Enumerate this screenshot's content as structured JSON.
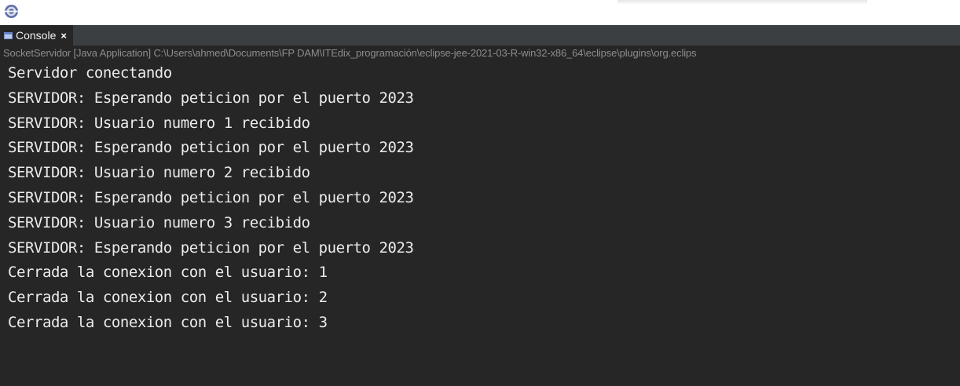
{
  "app": {
    "icon": "eclipse-icon"
  },
  "console": {
    "tab_label": "Console",
    "tab_icon": "console-icon",
    "close_glyph": "×",
    "launch_info": "SocketServidor [Java Application] C:\\Users\\ahmed\\Documents\\FP DAM\\ITEdix_programación\\eclipse-jee-2021-03-R-win32-x86_64\\eclipse\\plugins\\org.eclips",
    "lines": [
      "Servidor conectando",
      "SERVIDOR: Esperando peticion por el puerto 2023",
      "SERVIDOR: Usuario numero 1 recibido",
      "SERVIDOR: Esperando peticion por el puerto 2023",
      "SERVIDOR: Usuario numero 2 recibido",
      "SERVIDOR: Esperando peticion por el puerto 2023",
      "SERVIDOR: Usuario numero 3 recibido",
      "SERVIDOR: Esperando peticion por el puerto 2023",
      "Cerrada la conexion con el usuario: 1",
      "Cerrada la conexion con el usuario: 2",
      "Cerrada la conexion con el usuario: 3"
    ]
  },
  "colors": {
    "console_background": "#262626",
    "tab_bar_background": "#3c3f41",
    "output_text": "#ebebeb",
    "launch_info_text": "#8d8d8d"
  }
}
